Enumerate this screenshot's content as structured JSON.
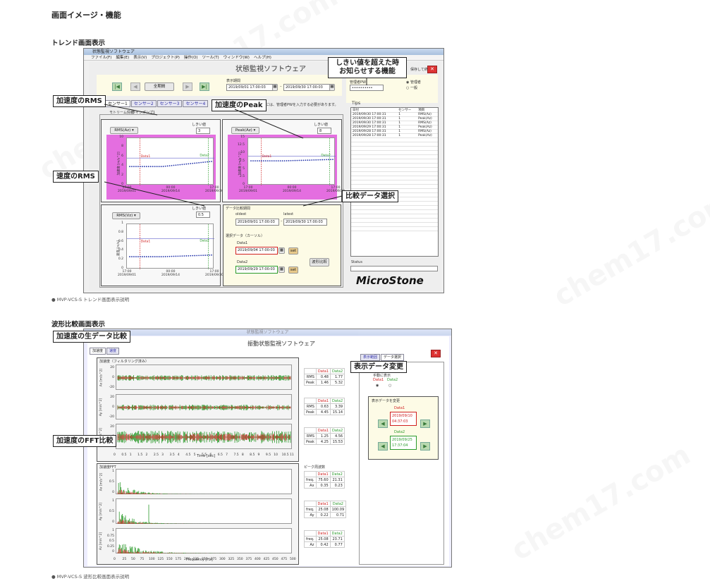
{
  "heading": "画面イメージ・機能",
  "section1": {
    "title": "トレンド画面表示",
    "caption": "● MVP-VCS-S トレンド画面表示説明",
    "window": {
      "titlebar": "状態監視ソフトウェア",
      "menu": [
        "ファイル(F)",
        "編集(E)",
        "表示(V)",
        "プロジェクト(P)",
        "操作(O)",
        "ツール(T)",
        "ウィンドウ(W)",
        "ヘルプ(H)"
      ],
      "app_title": "状態監視ソフトウェア",
      "all_period_button": "全期間",
      "display_period_label": "表示期間",
      "period_from": "2019/09/01 17:00:03",
      "period_to": "2019/09/30 17:00:03",
      "password_label": "管理者PW",
      "password_value": "••••••••••",
      "radio_admin": "管理者",
      "radio_general": "一般",
      "stop_button": "保存して終了",
      "hint": "表示するには、管理者PWを入力する必要があります。",
      "tabs": [
        "センサー1",
        "センサー2",
        "センサー3",
        "センサー4"
      ],
      "subtabs": [
        "モトリーム情報",
        "ラインポンプ1"
      ],
      "tips_label": "Tips",
      "tips_headers": [
        "日付",
        "センサー",
        "項目"
      ],
      "tips_rows": [
        [
          "2019/09/30 17:00:31",
          "1",
          "RMS(Az)"
        ],
        [
          "2019/09/30 17:00:31",
          "1",
          "Peak(Az)"
        ],
        [
          "2019/09/30 17:00:31",
          "1",
          "RMS(Az)"
        ],
        [
          "2019/09/29 17:00:31",
          "1",
          "Peak(Az)"
        ],
        [
          "2019/09/28 17:00:31",
          "1",
          "RMS(Az)"
        ],
        [
          "2019/09/28 17:00:31",
          "1",
          "Peak(Az)"
        ]
      ],
      "threshold_label": "しきい値",
      "rms_panel": {
        "selector": "RMS(Az)",
        "threshold": "3",
        "ylabel": "加速度 [m/s^2]",
        "y_ticks": [
          "10",
          "8",
          "6",
          "4",
          "2",
          "0"
        ]
      },
      "peak_panel": {
        "selector": "Peak(Az)",
        "threshold": "8",
        "ylabel": "加速度 [m/s^2]",
        "y_ticks": [
          "15",
          "12.5",
          "10",
          "7.5",
          "5",
          "2.5",
          "0"
        ]
      },
      "vel_panel": {
        "selector": "RMS(Vz)",
        "threshold": "0.5",
        "ylabel": "速度 [m/s]",
        "y_ticks": [
          "1",
          "0.8",
          "0.6",
          "0.4",
          "0.2",
          "0"
        ]
      },
      "x_ticks": [
        [
          "17:00",
          "2019/09/01"
        ],
        [
          "00:00",
          "2019/09/14"
        ],
        [
          "17:00",
          "2019/09/30"
        ]
      ],
      "data1_marker": "Data1",
      "data2_marker": "Data2",
      "compare": {
        "title": "データ比較期間",
        "oldest": "oldest",
        "latest": "latest",
        "from": "2019/09/01 17:00:03",
        "to": "2019/09/30 17:00:03",
        "cursor_label": "選択データ（カーソル）",
        "data1_label": "Data1",
        "data1_value": "2019/09/04 17:00:03",
        "data2_label": "Data2",
        "data2_value": "2019/09/29 17:00:03",
        "set": "set",
        "compare_button": "波形比較"
      },
      "status_label": "Status",
      "logo": "MicroStone"
    },
    "callouts": {
      "rms_acc": "加速度のRMS",
      "peak_acc": "加速度のPeak",
      "threshold_notice": "しきい値を超えた時\nお知らせする機能",
      "rms_vel": "速度のRMS",
      "compare_select": "比較データ選択"
    }
  },
  "section2": {
    "title": "波形比較画面表示",
    "caption": "● MVP-VCS-S 波形比較画面表示説明",
    "window": {
      "titlebar": "状態監視ソフトウェア",
      "app_title": "振動状態監視ソフトウェア",
      "tabs": [
        "加速度",
        "速度"
      ],
      "right_tabs": [
        "表示範囲",
        "データ選択"
      ],
      "raw_title": "加速度（フィルタリング済み）",
      "raw_ylabels": [
        "Ax [m/s^2]",
        "Ay [m/s^2]",
        "Az [m/s^2]"
      ],
      "raw_yticks": [
        "20",
        "0",
        "-20"
      ],
      "raw_xticks": [
        "0",
        "0.5",
        "1",
        "1.5",
        "2",
        "2.5",
        "3",
        "3.5",
        "4",
        "4.5",
        "5",
        "5.5",
        "6",
        "6.5",
        "7",
        "7.5",
        "8",
        "8.5",
        "9",
        "9.5",
        "10",
        "10.5",
        "11"
      ],
      "raw_xlabel": "Time [sec]",
      "raw_stats": [
        {
          "rows": [
            [
              "RMS",
              "0.48",
              "1.77"
            ],
            [
              "Peak",
              "1.46",
              "5.32"
            ]
          ]
        },
        {
          "rows": [
            [
              "RMS",
              "0.63",
              "3.39"
            ],
            [
              "Peak",
              "4.45",
              "15.14"
            ]
          ]
        },
        {
          "rows": [
            [
              "RMS",
              "1.25",
              "4.56"
            ],
            [
              "Peak",
              "4.25",
              "15.53"
            ]
          ]
        }
      ],
      "stat_headers": [
        "Data1",
        "Data2"
      ],
      "fft_title": "加速度FFT",
      "fft_ylabels": [
        "Ax [m/s^2]",
        "Ay [m/s^2]",
        "Az [m/s^2]"
      ],
      "fft_yticks": [
        [
          "1",
          "0.5",
          "0"
        ],
        [
          "1",
          "0.5",
          "0"
        ],
        [
          "1",
          "0.75",
          "0.5",
          "0.25",
          "0"
        ]
      ],
      "fft_xticks": [
        "0",
        "25",
        "50",
        "75",
        "100",
        "125",
        "150",
        "175",
        "200",
        "225",
        "250",
        "275",
        "300",
        "325",
        "350",
        "375",
        "400",
        "425",
        "450",
        "475",
        "500"
      ],
      "fft_xlabel": "Frequency [Hz]",
      "peak_freq_label": "ピーク周波数",
      "fft_stats": [
        {
          "rows": [
            [
              "freq.",
              "75.60",
              "21.31"
            ],
            [
              "Ax",
              "0.35",
              "0.23"
            ]
          ]
        },
        {
          "rows": [
            [
              "freq.",
              "25.08",
              "100.09"
            ],
            [
              "Ay",
              "0.22",
              "0.71"
            ]
          ]
        },
        {
          "rows": [
            [
              "freq.",
              "25.08",
              "23.71"
            ],
            [
              "Az",
              "0.42",
              "0.77"
            ]
          ]
        }
      ],
      "display_select_label": "手動に表示",
      "display_change_label": "表示データを変更",
      "data1_label": "Data1",
      "data1_date": "2019/09/10",
      "data1_time": "04:37:03",
      "data2_label": "Data2",
      "data2_date": "2019/09/25",
      "data2_time": "17:37:04"
    },
    "callouts": {
      "raw_compare": "加速度の生データ比較",
      "display_change": "表示データ変更",
      "fft_compare": "加速度のFFT比較"
    }
  },
  "watermark": "chem17.com",
  "colors": {
    "data1": "#d02020",
    "data2": "#2a9a2a",
    "series": "#2233aa",
    "highlight": "#e46ee0",
    "panel_bg": "#fdfbe6"
  }
}
